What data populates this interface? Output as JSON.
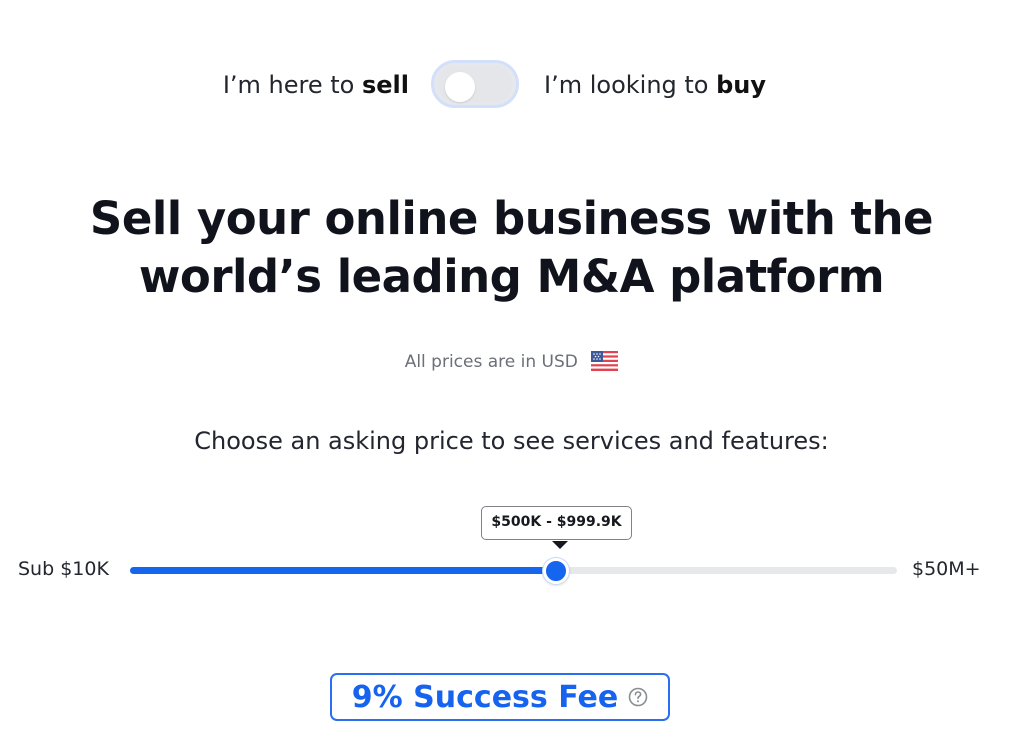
{
  "mode_toggle": {
    "sell_prefix": "I’m here to ",
    "sell_emphasis": "sell",
    "buy_prefix": "I’m looking to ",
    "buy_emphasis": "buy",
    "selected": "sell"
  },
  "hero": {
    "headline_line1": "Sell your online business with the",
    "headline_line2": "world’s leading M&A platform"
  },
  "currency": {
    "note": "All prices are in USD",
    "flag_icon": "us-flag-icon"
  },
  "price_selector": {
    "prompt": "Choose an asking price to see services and features:",
    "min_label": "Sub $10K",
    "max_label": "$50M+",
    "selected_range": "$500K - $999.9K",
    "position_fraction": 0.555
  },
  "fee": {
    "label": "9% Success Fee",
    "help_icon": "question-circle-icon"
  },
  "colors": {
    "accent": "#1565ef",
    "track": "#e7e8eb",
    "text": "#10131c",
    "muted": "#6b6f78"
  }
}
